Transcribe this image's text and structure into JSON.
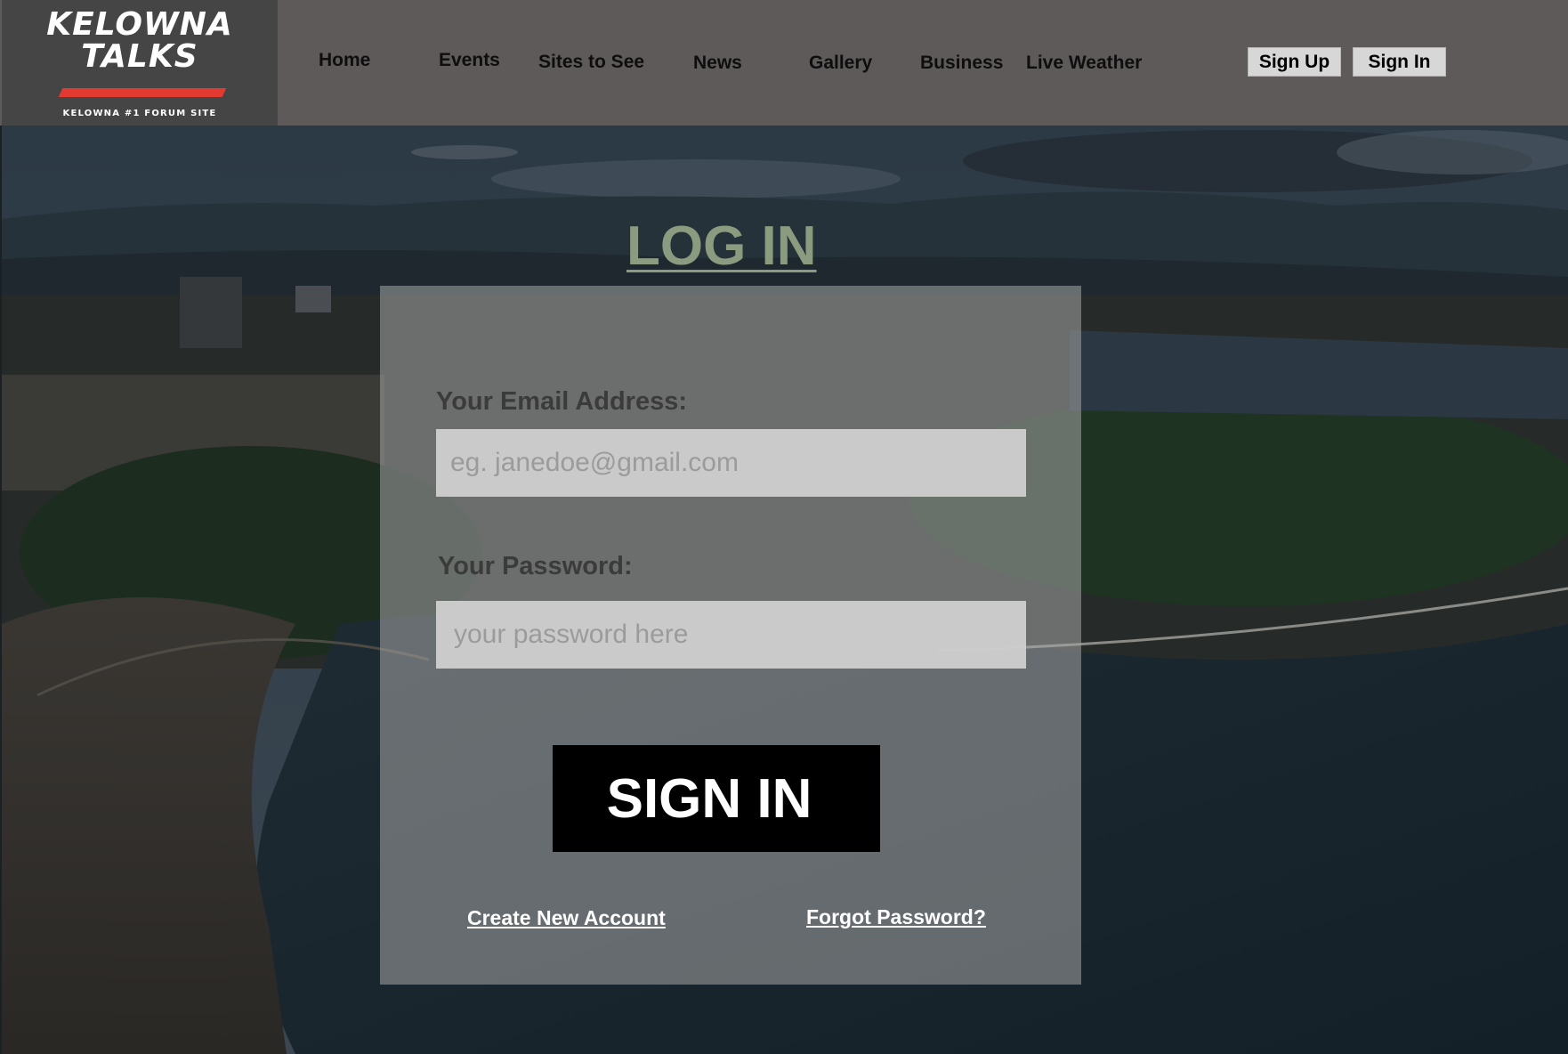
{
  "logo": {
    "line1": "KELOWNA",
    "line2": "TALKS",
    "tagline": "KELOWNA #1 FORUM SITE",
    "accent": "#e23a30"
  },
  "nav": {
    "items": [
      "Home",
      "Events",
      "Sites to See",
      "News",
      "Gallery",
      "Business",
      "Live Weather"
    ]
  },
  "header_buttons": {
    "sign_up": "Sign Up",
    "sign_in": "Sign In"
  },
  "login": {
    "title": "LOG IN",
    "email_label": "Your Email Address:",
    "email_placeholder": "eg. janedoe@gmail.com",
    "password_label": "Your Password:",
    "password_placeholder": "your password here",
    "submit_label": "SIGN IN",
    "create_account": "Create New Account",
    "forgot_password": "Forgot Password?"
  },
  "colors": {
    "header_bg": "#5d5a59",
    "logo_bg": "#464545",
    "title": "#8a9b7f",
    "button_bg": "#000000"
  }
}
